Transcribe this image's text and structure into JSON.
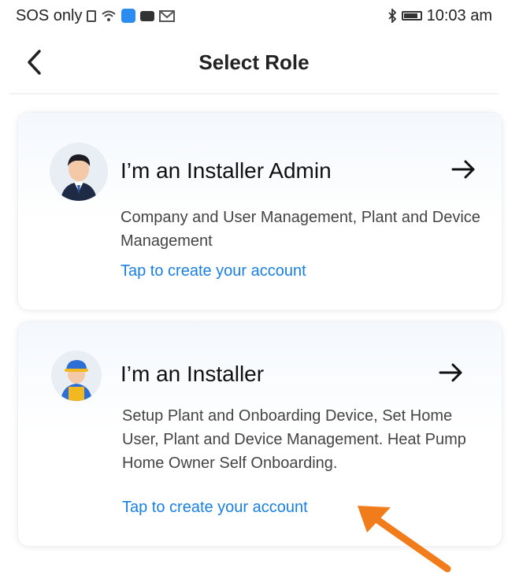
{
  "status_bar": {
    "carrier": "SOS only",
    "time": "10:03 am",
    "icons": [
      "sim-icon",
      "wifi-icon",
      "app-icon",
      "youtube-icon",
      "gmail-icon",
      "bluetooth-icon",
      "battery-icon"
    ]
  },
  "header": {
    "title": "Select Role",
    "back_icon": "chevron-left-icon"
  },
  "roles": [
    {
      "title": "I’m an Installer Admin",
      "description": "Company and User Management, Plant and Device Management",
      "link": "Tap to create your account",
      "avatar": "admin-avatar-icon",
      "arrow": "arrow-right-icon"
    },
    {
      "title": "I’m an Installer",
      "description": "Setup Plant and Onboarding Device, Set Home User, Plant and Device Management. Heat Pump Home Owner Self Onboarding.",
      "link": "Tap to create your account",
      "avatar": "installer-avatar-icon",
      "arrow": "arrow-right-icon"
    }
  ],
  "colors": {
    "link": "#1a7fe0",
    "annotation_arrow": "#f07c1c",
    "title": "#111111"
  }
}
